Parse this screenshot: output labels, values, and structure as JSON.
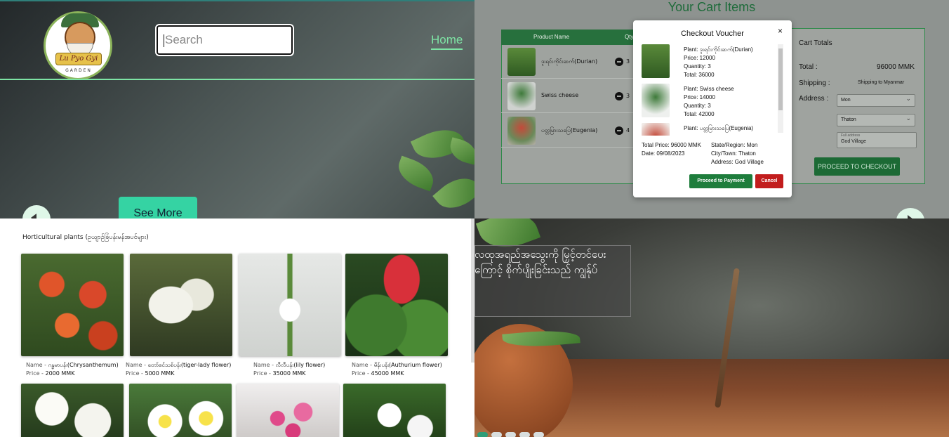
{
  "top_left": {
    "logo_text": "Lu Pyo Gyi",
    "logo_subtext": "GARDEN",
    "search_placeholder": "Search",
    "nav_home": "Home",
    "see_more": "See More"
  },
  "cart": {
    "title": "Your Cart Items",
    "columns": [
      "Product Name",
      "Qty"
    ],
    "rows": [
      {
        "name": "ဒူးရင်းကိုင်းဆက်(Durian)",
        "qty": "3"
      },
      {
        "name": "Swiss cheese",
        "qty": "3"
      },
      {
        "name": "ပတ္တမြားသပြေ(Eugenia)",
        "qty": "4"
      }
    ],
    "totals": {
      "heading": "Cart Totals",
      "total_label": "Total :",
      "total_value": "96000 MMK",
      "shipping_label": "Shipping :",
      "shipping_value": "Shipping to Myanmar",
      "address_label": "Address :",
      "region_value": "Mon",
      "town_value": "Thaton",
      "full_address_label": "Full address",
      "full_address_value": "God Village",
      "checkout_label": "PROCEED TO CHECKOUT"
    }
  },
  "voucher": {
    "title": "Checkout Voucher",
    "close": "×",
    "items": [
      {
        "plant": "Plant: ဒူးရင်းကိုင်းဆက်(Durian)",
        "price": "Price: 12000",
        "quantity": "Quantity: 3",
        "total": "Total: 36000"
      },
      {
        "plant": "Plant: Swiss cheese",
        "price": "Price: 14000",
        "quantity": "Quantity: 3",
        "total": "Total: 42000"
      },
      {
        "plant": "Plant: ပတ္တမြားသပြေ(Eugenia)",
        "price": "",
        "quantity": "",
        "total": ""
      }
    ],
    "total_price": "Total Price: 96000 MMK",
    "date": "Date: 09/08/2023",
    "state": "State/Region: Mon",
    "city": "City/Town: Thaton",
    "address": "Address: God Village",
    "pay_label": "Proceed to Payment",
    "cancel_label": "Cancel"
  },
  "plants": {
    "section_title": "Horticultural plants (ဥယျာဉ်ခြံပန်းမန်အပင်များ)",
    "name_prefix": "Name - ",
    "price_prefix": "Price - ",
    "cards": [
      {
        "name": "ဂန္ဓမာပန်း(Chrysanthemum)",
        "price": "2000 MMK"
      },
      {
        "name": "တော်စင်သစ်ပန်း(tiger-lady flower)",
        "price": "5000 MMK"
      },
      {
        "name": "လီလီပန်း(lily flower)",
        "price": "35000 MMK"
      },
      {
        "name": "မိန်းပန်း(Authurium flower)",
        "price": "45000 MMK"
      }
    ]
  },
  "slide": {
    "caption_line1": "လထုအရည်အသွေးကို မြှင့်တင်ပေး",
    "caption_line2": "ကြောင့် စိုက်ပျိုးခြင်းသည် ကျွန်ုပ်"
  },
  "colors": {
    "accent_green": "#7ee4a5",
    "see_more_bg": "#35d3a3",
    "cart_header": "#27703d",
    "pay_button": "#1e7d3c",
    "cancel_button": "#c21d1d"
  }
}
